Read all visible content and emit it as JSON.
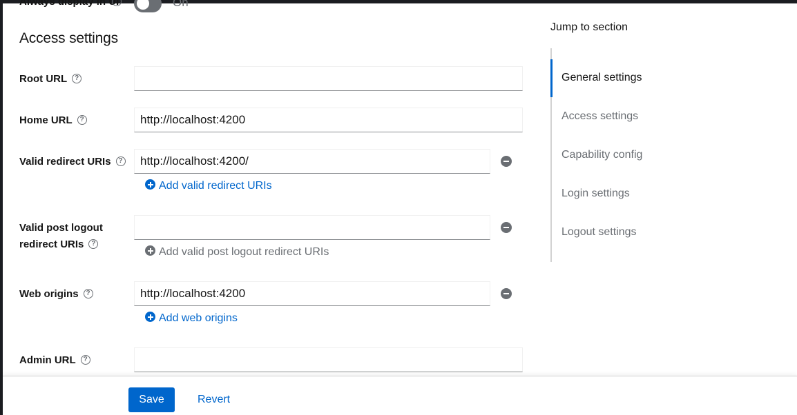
{
  "clipped_row": {
    "label": "Always display in UI",
    "toggle_text": "On"
  },
  "section": {
    "title": "Access settings"
  },
  "fields": {
    "root_url": {
      "label": "Root URL",
      "value": ""
    },
    "home_url": {
      "label": "Home URL",
      "value": "http://localhost:4200"
    },
    "valid_redirect_uris": {
      "label": "Valid redirect URIs",
      "value": "http://localhost:4200/",
      "add_label": "Add valid redirect URIs"
    },
    "valid_post_logout": {
      "label_line1": "Valid post logout",
      "label_line2": "redirect URIs",
      "value": "",
      "add_label": "Add valid post logout redirect URIs"
    },
    "web_origins": {
      "label": "Web origins",
      "value": "http://localhost:4200",
      "add_label": "Add web origins"
    },
    "admin_url": {
      "label": "Admin URL",
      "value": ""
    }
  },
  "help_glyph": "?",
  "jump": {
    "title": "Jump to section",
    "items": [
      "General settings",
      "Access settings",
      "Capability config",
      "Login settings",
      "Logout settings"
    ],
    "active_index": 0
  },
  "footer": {
    "save_label": "Save",
    "revert_label": "Revert"
  },
  "colors": {
    "accent": "#0066cc",
    "muted": "#6a6e73"
  }
}
